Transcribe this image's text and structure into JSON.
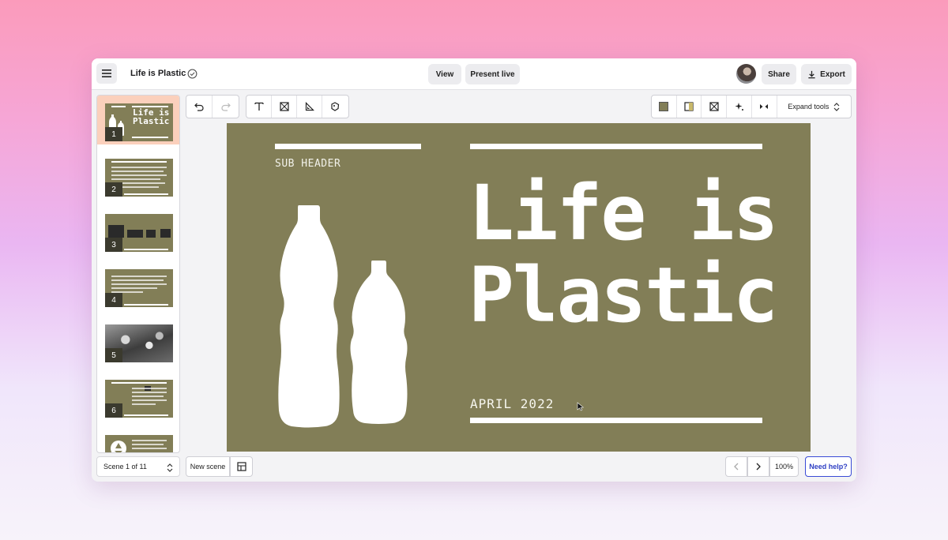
{
  "app": {
    "doc_title": "Life is Plastic",
    "view_label": "View",
    "present_label": "Present live",
    "share_label": "Share",
    "export_label": "Export"
  },
  "toolbar": {
    "expand_tools_label": "Expand tools",
    "colors": {
      "swatch": "#827e57"
    }
  },
  "slide": {
    "sub_header": "SUB HEADER",
    "title": "Life is\nPlastic",
    "date": "APRIL 2022",
    "background": "#827e57"
  },
  "sidebar": {
    "thumbnails": [
      {
        "num": "1",
        "title": "Life is\nPlastic"
      },
      {
        "num": "2"
      },
      {
        "num": "3"
      },
      {
        "num": "4"
      },
      {
        "num": "5"
      },
      {
        "num": "6"
      },
      {
        "num": ""
      }
    ],
    "scene_label": "Scene 1 of 11"
  },
  "bottom": {
    "new_scene_label": "New scene",
    "zoom": "100%",
    "help_label": "Need help?"
  }
}
